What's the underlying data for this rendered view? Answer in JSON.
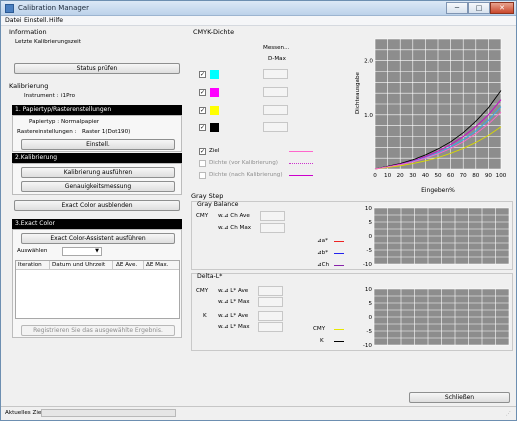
{
  "window": {
    "title": "Calibration Manager",
    "min_label": "─",
    "max_label": "□",
    "close_label": "✕"
  },
  "menu": [
    "Datei",
    "Einstell.",
    "Hilfe"
  ],
  "information": {
    "heading": "Information",
    "last_calibration_label": "Letzte Kalibrierungszeit",
    "status_button": "Status prüfen"
  },
  "kalibrierung": {
    "heading": "Kalibrierung",
    "instrument_label": "Instrument :",
    "instrument_value": "i1Pro"
  },
  "section1": {
    "header": "1. Papiertyp/Rasterenstellungen",
    "paper_label": "Papiertyp :",
    "paper_value": "Normalpapier",
    "raster_label": "Rastereinstellungen :",
    "raster_value": "Raster 1(Dot190)",
    "settings_button": "Einstell."
  },
  "section2": {
    "header": "2.Kalibrierung",
    "run_button": "Kalibrierung ausführen",
    "accuracy_button": "Genauigkeitsmessung"
  },
  "exact_hide_button": "Exact Color ausblenden",
  "section3": {
    "header": "3.Exact Color",
    "assistant_button": "Exact Color-Assistent ausführen",
    "select_label": "Auswählen",
    "table_headers": [
      "Iteration",
      "Datum und Uhrzeit",
      "ΔE Ave.",
      "ΔE Max."
    ],
    "register_button": "Registrieren Sie das ausgewählte Ergebnis."
  },
  "cmyk": {
    "heading": "CMYK-Dichte",
    "measured_label": "Messen...",
    "dmax_label": "D-Max",
    "colors": [
      {
        "name": "C",
        "hex": "#00ffff",
        "checked": "✓"
      },
      {
        "name": "M",
        "hex": "#ff00ff",
        "checked": "✓"
      },
      {
        "name": "Y",
        "hex": "#ffff00",
        "checked": "✓"
      },
      {
        "name": "K",
        "hex": "#000000",
        "checked": "✓"
      }
    ],
    "legend": [
      {
        "label": "Ziel",
        "checked": "✓",
        "enabled": true,
        "color": "#ff66cc",
        "style": "solid"
      },
      {
        "label": "Dichte (vor Kalibrierung)",
        "checked": "",
        "enabled": false,
        "color": "#cc33cc",
        "style": "dotted"
      },
      {
        "label": "Dichte (nach Kalibrierung)",
        "checked": "",
        "enabled": false,
        "color": "#cc00cc",
        "style": "solid"
      }
    ]
  },
  "chart_data": {
    "type": "line",
    "xlabel": "Eingeben%",
    "ylabel": "Dichteausgabe",
    "xlim": [
      0,
      100
    ],
    "ylim": [
      0,
      2.4
    ],
    "x_ticks": [
      "0",
      "10",
      "20",
      "30",
      "40",
      "50",
      "60",
      "70",
      "80",
      "90",
      "100"
    ],
    "y_ticks": [
      "2.0",
      "1.0"
    ],
    "grid": true,
    "x": [
      0,
      10,
      20,
      30,
      40,
      50,
      60,
      70,
      80,
      90,
      100
    ],
    "series": [
      {
        "name": "K",
        "color": "#000000",
        "values": [
          0.0,
          0.05,
          0.1,
          0.17,
          0.26,
          0.37,
          0.5,
          0.67,
          0.88,
          1.13,
          1.45
        ]
      },
      {
        "name": "M",
        "color": "#cc00cc",
        "values": [
          0.0,
          0.04,
          0.09,
          0.15,
          0.23,
          0.33,
          0.45,
          0.6,
          0.78,
          1.0,
          1.28
        ]
      },
      {
        "name": "C",
        "color": "#33aaee",
        "values": [
          0.0,
          0.04,
          0.08,
          0.14,
          0.21,
          0.3,
          0.41,
          0.54,
          0.7,
          0.9,
          1.15
        ]
      },
      {
        "name": "Y",
        "color": "#d8d800",
        "values": [
          0.0,
          0.03,
          0.06,
          0.1,
          0.15,
          0.21,
          0.29,
          0.38,
          0.49,
          0.62,
          0.78
        ]
      },
      {
        "name": "Ziel",
        "color": "#ff66cc",
        "values": [
          0.0,
          0.04,
          0.08,
          0.13,
          0.2,
          0.28,
          0.38,
          0.5,
          0.65,
          0.83,
          1.05
        ]
      }
    ]
  },
  "graystep": {
    "heading": "Gray Step",
    "balance_heading": "Gray Balance",
    "cmy_label": "CMY",
    "ch_ave_label": "w.⊿ Ch Ave",
    "ch_max_label": "w.⊿ Ch Max",
    "balance_legend": [
      {
        "label": "⊿a*",
        "color": "#ee2222"
      },
      {
        "label": "⊿b*",
        "color": "#2222ee"
      },
      {
        "label": "⊿Ch",
        "color": "#8822aa"
      }
    ],
    "y_ticks": [
      "10",
      "5",
      "0",
      "-5",
      "-10"
    ],
    "delta_heading": "Delta-L*",
    "k_label": "K",
    "l_ave_label": "w.⊿ L* Ave",
    "l_max_label": "w.⊿ L* Max",
    "delta_legend": [
      {
        "label": "CMY",
        "color": "#e6e600"
      },
      {
        "label": "K",
        "color": "#000000"
      }
    ]
  },
  "close_button": "Schließen",
  "status": {
    "label": "Aktuelles Ziel"
  }
}
